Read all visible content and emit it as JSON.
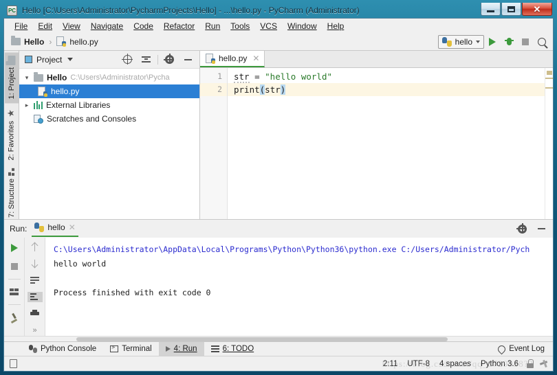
{
  "window": {
    "title": "Hello [C:\\Users\\Administrator\\PycharmProjects\\Hello] - ...\\hello.py - PyCharm (Administrator)",
    "app_badge": "PC",
    "controls": {
      "minimize": "–",
      "maximize": "□",
      "close": "✕"
    }
  },
  "menu": [
    {
      "label": "File"
    },
    {
      "label": "Edit"
    },
    {
      "label": "View"
    },
    {
      "label": "Navigate"
    },
    {
      "label": "Code"
    },
    {
      "label": "Refactor"
    },
    {
      "label": "Run"
    },
    {
      "label": "Tools"
    },
    {
      "label": "VCS"
    },
    {
      "label": "Window"
    },
    {
      "label": "Help"
    }
  ],
  "navbar": {
    "breadcrumb": [
      {
        "label": "Hello",
        "icon": "folder-icon"
      },
      {
        "label": "hello.py",
        "icon": "python-file-icon"
      }
    ],
    "separator": "›",
    "run_config": {
      "name": "hello",
      "icon": "python-icon"
    },
    "buttons": [
      {
        "name": "run-button",
        "icon": "play-icon"
      },
      {
        "name": "debug-button",
        "icon": "bug-icon"
      },
      {
        "name": "stop-button",
        "icon": "stop-icon"
      },
      {
        "name": "search-everywhere-button",
        "icon": "search-icon"
      }
    ]
  },
  "left_tool_tabs": [
    {
      "label": "1: Project",
      "active": true,
      "icon": "folder-icon"
    },
    {
      "label": "2: Favorites",
      "active": false,
      "icon": "star-icon"
    },
    {
      "label": "7: Structure",
      "active": false,
      "icon": "structure-icon"
    }
  ],
  "project_panel": {
    "title": "Project",
    "toolbar": [
      {
        "name": "locate-button",
        "icon": "target-icon"
      },
      {
        "name": "collapse-all-button",
        "icon": "collapse-all-icon"
      },
      {
        "name": "settings-button",
        "icon": "gear-icon"
      },
      {
        "name": "hide-button",
        "icon": "minus-icon"
      }
    ],
    "tree": [
      {
        "label": "Hello",
        "path": "C:\\Users\\Administrator\\Pycha",
        "icon": "folder-icon",
        "expanded": true,
        "bold": true,
        "selected": false,
        "indent": 0
      },
      {
        "label": "hello.py",
        "path": "",
        "icon": "python-file-icon",
        "expanded": null,
        "bold": false,
        "selected": true,
        "indent": 1
      },
      {
        "label": "External Libraries",
        "path": "",
        "icon": "library-icon",
        "expanded": false,
        "bold": false,
        "selected": false,
        "indent": 0
      },
      {
        "label": "Scratches and Consoles",
        "path": "",
        "icon": "scratches-icon",
        "expanded": null,
        "bold": false,
        "selected": false,
        "indent": 0
      }
    ]
  },
  "editor": {
    "tabs": [
      {
        "label": "hello.py",
        "icon": "python-file-icon",
        "active": true,
        "close": "✕"
      }
    ],
    "lines": [
      {
        "number": "1",
        "current": false,
        "tokens": [
          {
            "text": "str",
            "type": "plain-squiggle"
          },
          {
            "text": " = ",
            "type": "plain"
          },
          {
            "text": "\"hello world\"",
            "type": "string"
          }
        ]
      },
      {
        "number": "2",
        "current": true,
        "tokens": [
          {
            "text": "print",
            "type": "plain"
          },
          {
            "text": "(",
            "type": "paren-highlight"
          },
          {
            "text": "str",
            "type": "plain"
          },
          {
            "text": ")",
            "type": "paren-highlight"
          }
        ]
      }
    ]
  },
  "run_window": {
    "label": "Run:",
    "tab": {
      "label": "hello",
      "icon": "python-icon",
      "close": "✕"
    },
    "header_buttons": [
      {
        "name": "settings-button",
        "icon": "gear-icon"
      },
      {
        "name": "hide-button",
        "icon": "minus-icon"
      }
    ],
    "left_tools": [
      {
        "name": "rerun-button",
        "icon": "play-icon"
      },
      {
        "name": "stop-button",
        "icon": "stop-icon"
      },
      {
        "name": "layout-button",
        "icon": "layout-icon"
      },
      {
        "name": "pin-tab-button",
        "icon": "pin-icon"
      }
    ],
    "right_tools": [
      {
        "name": "up-the-stack-button",
        "icon": "arrow-up-icon"
      },
      {
        "name": "down-the-stack-button",
        "icon": "arrow-down-icon"
      },
      {
        "name": "soft-wrap-button",
        "icon": "wrap-icon"
      },
      {
        "name": "scroll-to-end-button",
        "icon": "scroll-end-icon",
        "active": true
      },
      {
        "name": "print-button",
        "icon": "print-icon"
      },
      {
        "name": "more-button",
        "icon": "chevron-double-icon",
        "glyph": "»"
      }
    ],
    "console": [
      {
        "text": "C:\\Users\\Administrator\\AppData\\Local\\Programs\\Python\\Python36\\python.exe C:/Users/Administrator/Pych",
        "type": "command"
      },
      {
        "text": "hello world",
        "type": "output"
      },
      {
        "text": "",
        "type": "output"
      },
      {
        "text": "Process finished with exit code 0",
        "type": "output"
      }
    ]
  },
  "bottom_tabs": [
    {
      "label": "Python Console",
      "icon": "python-icon",
      "active": false
    },
    {
      "label": "Terminal",
      "icon": "terminal-icon",
      "active": false
    },
    {
      "label": "4: Run",
      "icon": "play-icon",
      "active": true
    },
    {
      "label": "6: TODO",
      "icon": "todo-icon",
      "active": false
    }
  ],
  "event_log": {
    "label": "Event Log",
    "icon": "balloon-icon"
  },
  "statusbar": {
    "doc_icon": "document-icon",
    "watermark": "https://blog.csdn.net/qq_6729938?2",
    "items": [
      {
        "label": "2:11",
        "name": "caret-position"
      },
      {
        "label": "UTF-8",
        "name": "encoding"
      },
      {
        "label": "4 spaces",
        "name": "indent"
      },
      {
        "label": "Python 3.6",
        "name": "interpreter"
      }
    ],
    "icons": [
      {
        "name": "lock-icon"
      },
      {
        "name": "hammer-icon"
      }
    ]
  },
  "colors": {
    "accent": "#2b7fd4",
    "green": "#3c9a3c",
    "string": "#2a7a2a",
    "titlebar": "#1b6f90",
    "current_line": "#fdf6e3"
  }
}
